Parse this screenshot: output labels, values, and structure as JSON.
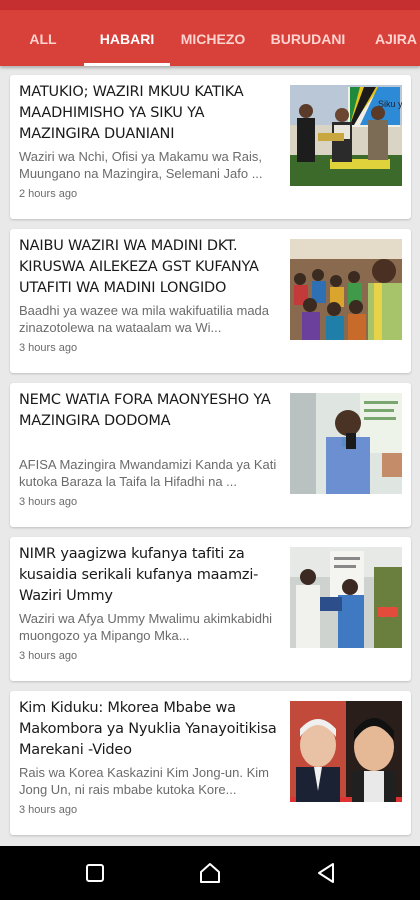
{
  "tabs": [
    {
      "label": "ALL"
    },
    {
      "label": "HABARI"
    },
    {
      "label": "MICHEZO"
    },
    {
      "label": "BURUDANI"
    },
    {
      "label": "AJIRA"
    }
  ],
  "active_tab": "HABARI",
  "articles": [
    {
      "title": "MATUKIO; WAZIRI MKUU KATIKA MAADHIMISHO YA SIKU YA MAZINGIRA DUANIANI",
      "excerpt": "Waziri wa Nchi, Ofisi ya Makamu wa Rais, Muungano na Mazingira, Selemani Jafo ...",
      "time": "2 hours ago",
      "thumb_text": "Siku ya"
    },
    {
      "title": "NAIBU WAZIRI WA MADINI DKT. KIRUSWA AILEKEZA GST KUFANYA UTAFITI WA MADINI LONGIDO",
      "excerpt": "Baadhi ya wazee wa mila wakifuatilia mada zinazotolewa na wataalam wa Wi...",
      "time": "3 hours ago"
    },
    {
      "title": "NEMC WATIA FORA MAONYESHO YA MAZINGIRA DODOMA",
      "excerpt": "AFISA Mazingira Mwandamizi Kanda ya Kati kutoka Baraza la Taifa la Hifadhi na ...",
      "time": "3 hours ago"
    },
    {
      "title": "NIMR yaagizwa kufanya tafiti za kusaidia serikali kufanya maamzi-Waziri Ummy",
      "excerpt": "Waziri wa Afya Ummy Mwalimu akimkabidhi muongozo ya Mipango Mka...",
      "time": "3 hours ago"
    },
    {
      "title": "Kim Kiduku: Mkorea Mbabe wa Makombora ya Nyuklia Yanayoitikisa Marekani -Video",
      "excerpt": "Rais wa Korea Kaskazini Kim Jong-un. Kim Jong Un, ni rais mbabe kutoka Kore...",
      "time": "3 hours ago"
    }
  ],
  "nav": {
    "recent": "recent-apps-icon",
    "home": "home-icon",
    "back": "back-icon"
  },
  "colors": {
    "accent": "#d8403a",
    "status": "#c62f2f",
    "background": "#e9e9e9"
  }
}
